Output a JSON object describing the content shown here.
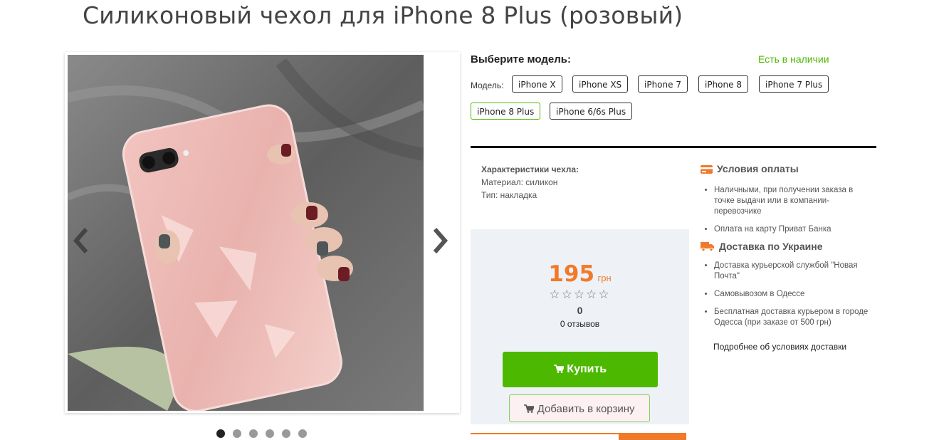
{
  "product": {
    "title": "Силиконовый чехол для iPhone 8 Plus (розовый)"
  },
  "gallery": {
    "dots": [
      true,
      false,
      false,
      false,
      false,
      false
    ]
  },
  "models": {
    "choose_label": "Выберите модель:",
    "stock_status": "Есть в наличии",
    "model_label": "Модель:",
    "options": [
      "iPhone X",
      "iPhone XS",
      "iPhone 7",
      "iPhone 8",
      "iPhone 7 Plus",
      "iPhone 8 Plus",
      "iPhone 6/6s Plus"
    ],
    "selected": "iPhone 8 Plus"
  },
  "characteristics": {
    "heading": "Характеристики чехла:",
    "material": "Материал: силикон",
    "type": "Тип: накладка"
  },
  "pricing": {
    "price": "195",
    "currency": "грн",
    "stars": "☆☆☆☆☆",
    "rating": "0",
    "reviews": "0 отзывов",
    "buy_label": "Купить",
    "cart_label": "Добавить в корзину"
  },
  "payment": {
    "heading": "Условия оплаты",
    "items": [
      "Наличными, при получении заказа в точке выдачи или в компании-перевозчике",
      "Оплата на карту Приват Банка"
    ]
  },
  "delivery": {
    "heading": "Доставка по Украине",
    "items": [
      "Доставка курьерской службой \"Новая Почта\"",
      "Самовывозом в Одессе",
      "Бесплатная доставка курьером в городе Одесса (при заказе от 500 грн)"
    ],
    "more_link": "Подробнее об условиях доставки"
  },
  "colors": {
    "accent_green": "#4db800",
    "price_orange": "#f07a2a"
  }
}
